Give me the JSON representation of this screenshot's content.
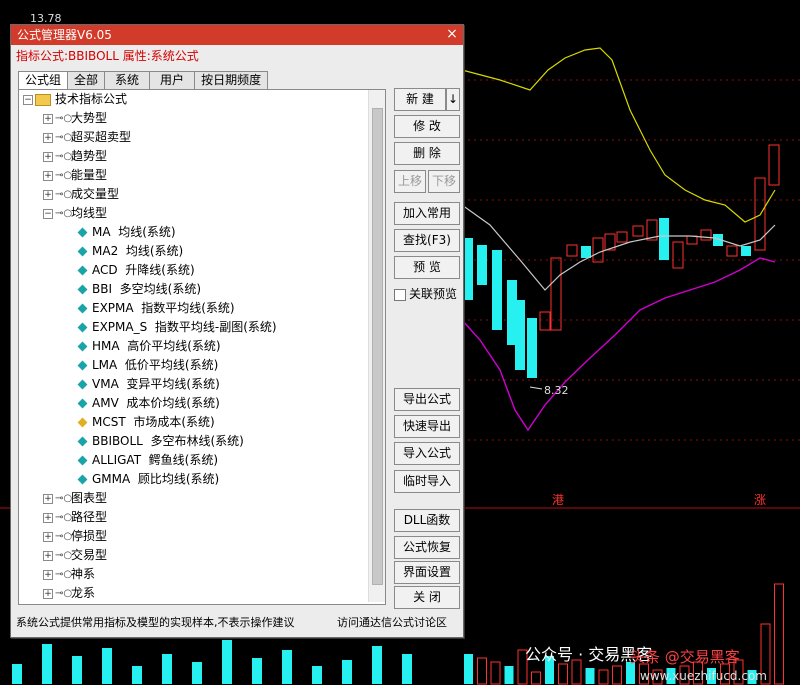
{
  "window": {
    "title": "公式管理器V6.05",
    "close_label": "×"
  },
  "formula_info": "指标公式:BBIBOLL 属性:系统公式",
  "tabs": [
    "公式组",
    "全部",
    "系统",
    "用户",
    "按日期频度"
  ],
  "tree": {
    "root": "技术指标公式",
    "groups_top": [
      "大势型",
      "超买超卖型",
      "趋势型",
      "能量型",
      "成交量型"
    ],
    "expanded_group": "均线型",
    "items": [
      {
        "code": "MA",
        "name": "均线(系统)",
        "icon": "cyan-diamond"
      },
      {
        "code": "MA2",
        "name": "均线(系统)",
        "icon": "cyan-diamond"
      },
      {
        "code": "ACD",
        "name": "升降线(系统)",
        "icon": "cyan-diamond"
      },
      {
        "code": "BBI",
        "name": "多空均线(系统)",
        "icon": "cyan-diamond"
      },
      {
        "code": "EXPMA",
        "name": "指数平均线(系统)",
        "icon": "cyan-diamond"
      },
      {
        "code": "EXPMA_S",
        "name": "指数平均线-副图(系统)",
        "icon": "cyan-diamond"
      },
      {
        "code": "HMA",
        "name": "高价平均线(系统)",
        "icon": "cyan-diamond"
      },
      {
        "code": "LMA",
        "name": "低价平均线(系统)",
        "icon": "cyan-diamond"
      },
      {
        "code": "VMA",
        "name": "变异平均线(系统)",
        "icon": "cyan-diamond"
      },
      {
        "code": "AMV",
        "name": "成本价均线(系统)",
        "icon": "cyan-diamond"
      },
      {
        "code": "MCST",
        "name": "市场成本(系统)",
        "icon": "yellow-diamond"
      },
      {
        "code": "BBIBOLL",
        "name": "多空布林线(系统)",
        "icon": "cyan-diamond"
      },
      {
        "code": "ALLIGAT",
        "name": "鳄鱼线(系统)",
        "icon": "cyan-diamond"
      },
      {
        "code": "GMMA",
        "name": "顾比均线(系统)",
        "icon": "cyan-diamond"
      }
    ],
    "groups_bottom": [
      "图表型",
      "路径型",
      "停损型",
      "交易型",
      "神系",
      "龙系"
    ]
  },
  "buttons": {
    "new": "新 建",
    "new_arrow": "↓",
    "modify": "修 改",
    "delete": "删 除",
    "move_up": "上移",
    "move_down": "下移",
    "add_common": "加入常用",
    "find": "查找(F3)",
    "preview": "预 览",
    "linked_preview": "关联预览",
    "export": "导出公式",
    "quick_export": "快速导出",
    "import": "导入公式",
    "temp_import": "临时导入",
    "dll": "DLL函数",
    "restore": "公式恢复",
    "ui_settings": "界面设置",
    "close": "关 闭"
  },
  "status_left": "系统公式提供常用指标及模型的实现样本,不表示操作建议",
  "status_right": "访问通达信公式讨论区",
  "chart": {
    "price_top": "13.78",
    "price_low": "8.32",
    "marker_1": "港",
    "marker_2": "涨",
    "watermark": "公众号 · 交易黑客",
    "watermark2": "头条 @交易黑客",
    "watermark3": "www.xuezhifucd.com",
    "colors": {
      "up": "#ff3030",
      "down": "#27f0f0",
      "upper_band": "#d8d800",
      "lower_band": "#d000d0",
      "mid": "#c8c8c8"
    }
  }
}
